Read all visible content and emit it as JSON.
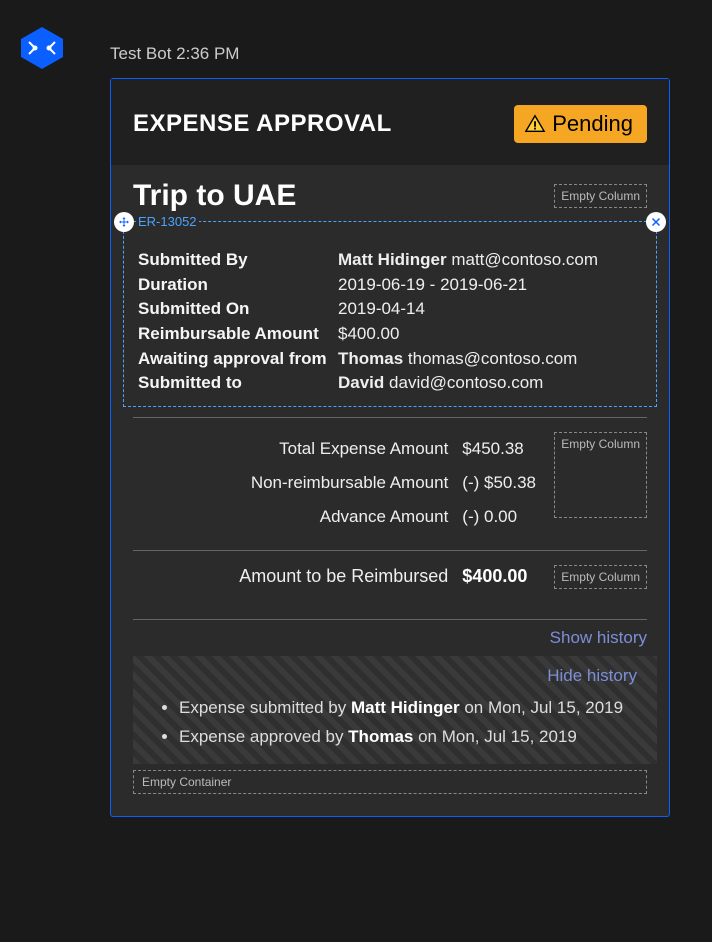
{
  "header": {
    "bot_name": "Test Bot",
    "timestamp": "2:36 PM"
  },
  "card": {
    "title": "EXPENSE APPROVAL",
    "status": "Pending",
    "trip_title": "Trip to UAE",
    "reference": "ER-13052",
    "empty_column_label": "Empty Column",
    "empty_container_label": "Empty Container"
  },
  "facts": {
    "submitted_by_label": "Submitted By",
    "submitted_by_name": "Matt Hidinger",
    "submitted_by_email": "matt@contoso.com",
    "duration_label": "Duration",
    "duration_value": "2019-06-19 - 2019-06-21",
    "submitted_on_label": "Submitted On",
    "submitted_on_value": "2019-04-14",
    "reimbursable_label": "Reimbursable Amount",
    "reimbursable_value": "$400.00",
    "awaiting_label": "Awaiting approval from",
    "awaiting_name": "Thomas",
    "awaiting_email": "thomas@contoso.com",
    "submitted_to_label": "Submitted to",
    "submitted_to_name": "David",
    "submitted_to_email": "david@contoso.com"
  },
  "totals": {
    "total_label": "Total Expense Amount",
    "total_value": "$450.38",
    "nonreimb_label": "Non-reimbursable Amount",
    "nonreimb_value": "(-) $50.38",
    "advance_label": "Advance Amount",
    "advance_value": "(-) 0.00",
    "reimburse_label": "Amount to be Reimbursed",
    "reimburse_value": "$400.00"
  },
  "links": {
    "show_history": "Show history",
    "hide_history": "Hide history"
  },
  "history": {
    "item1_prefix": "Expense submitted by ",
    "item1_name": "Matt Hidinger",
    "item1_suffix": " on Mon, Jul 15, 2019",
    "item2_prefix": "Expense approved by ",
    "item2_name": "Thomas",
    "item2_suffix": " on Mon, Jul 15, 2019"
  }
}
